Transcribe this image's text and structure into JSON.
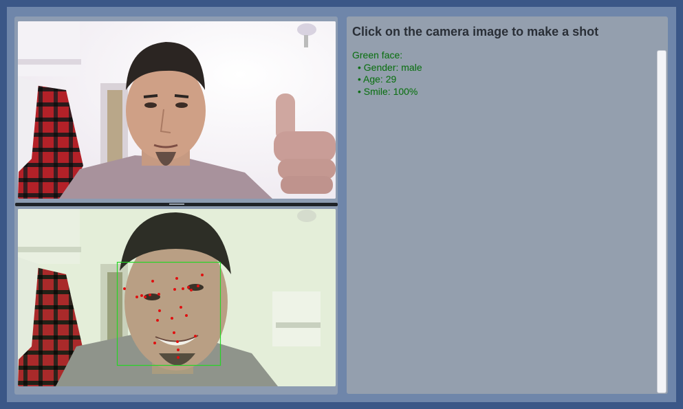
{
  "window": {
    "bg": "#3b5787",
    "panel_bg": "#949fae"
  },
  "right": {
    "title": "Click on the camera image to make a shot",
    "face_label": "Green face:",
    "items": [
      "• Gender: male",
      "• Age: 29",
      "• Smile: 100%"
    ],
    "text_color": "#0f6a17"
  },
  "camera": {
    "live_view_name": "live-camera",
    "shot_view_name": "captured-shot",
    "face_box_color": "#25d625",
    "landmark_color": "#e01010"
  }
}
